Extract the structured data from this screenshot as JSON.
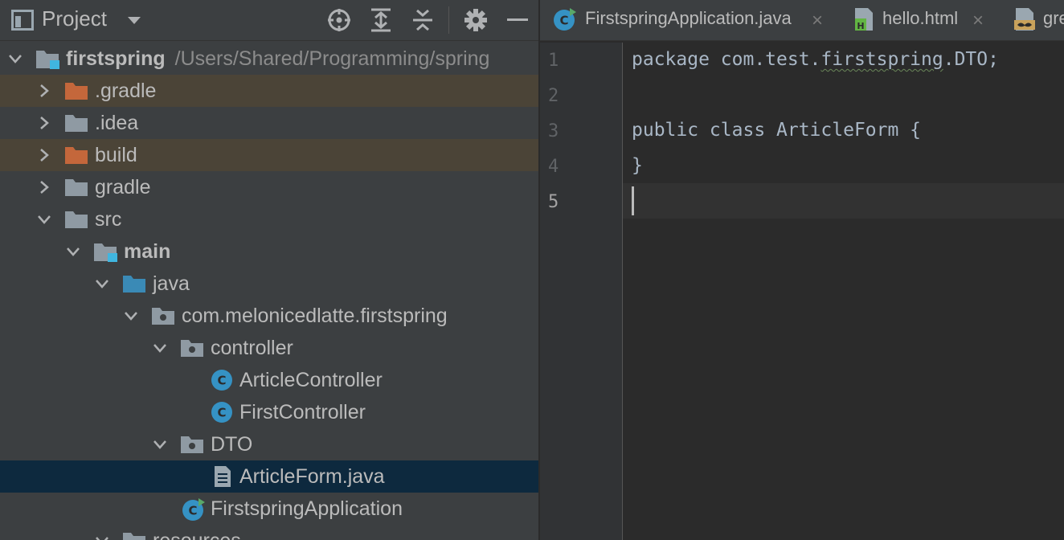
{
  "project_panel": {
    "title": "Project",
    "tree": [
      {
        "label": "firstspring",
        "path": "/Users/Shared/Programming/spring",
        "bold": true
      },
      {
        "label": ".gradle"
      },
      {
        "label": ".idea"
      },
      {
        "label": "build"
      },
      {
        "label": "gradle"
      },
      {
        "label": "src"
      },
      {
        "label": "main",
        "bold": true
      },
      {
        "label": "java"
      },
      {
        "label": "com.melonicedlatte.firstspring"
      },
      {
        "label": "controller"
      },
      {
        "label": "ArticleController"
      },
      {
        "label": "FirstController"
      },
      {
        "label": "DTO"
      },
      {
        "label": "ArticleForm.java"
      },
      {
        "label": "FirstspringApplication"
      },
      {
        "label": "resources"
      }
    ]
  },
  "editor": {
    "tabs": [
      {
        "label": "FirstspringApplication.java",
        "close": "×"
      },
      {
        "label": "hello.html",
        "close": "×"
      },
      {
        "label": "gre"
      }
    ],
    "line_numbers": [
      "1",
      "2",
      "3",
      "4",
      "5"
    ],
    "code": {
      "line1_a": "package com.test.",
      "line1_b": "firstspring",
      "line1_c": ".DTO;",
      "line3": "public class ArticleForm {",
      "line4": "}"
    }
  },
  "colors": {
    "panel_bg": "#3c3f41",
    "editor_bg": "#2b2b2b",
    "excluded_row": "#4b4437",
    "selected_row": "#0d293e",
    "folder_excluded": "#c4673b",
    "folder_normal": "#8f9aa3",
    "folder_source": "#3a8ab6",
    "class_icon": "#3592c4"
  },
  "icons": {
    "panel": "project-window-icon",
    "dropdown": "chevron-down-icon",
    "locate": "crosshair-icon",
    "expand": "expand-all-icon",
    "collapse": "collapse-all-icon",
    "settings": "gear-icon",
    "hide": "minimize-icon"
  }
}
